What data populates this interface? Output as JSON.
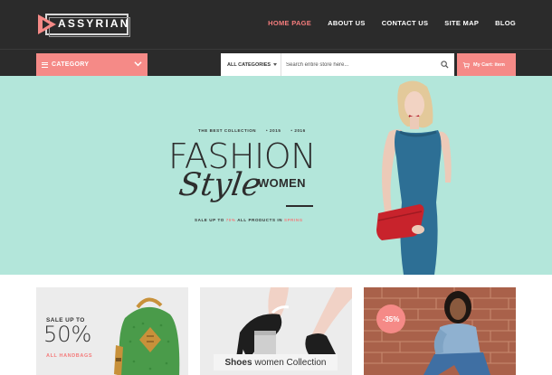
{
  "brand": {
    "logo_text": "ASSYRIAN",
    "accent": "#f58a87",
    "dark": "#2b2b2b"
  },
  "nav": {
    "items": [
      {
        "label": "HOME PAGE",
        "active": true
      },
      {
        "label": "ABOUT US",
        "active": false
      },
      {
        "label": "CONTACT US",
        "active": false
      },
      {
        "label": "SITE MAP",
        "active": false
      },
      {
        "label": "BLOG",
        "active": false
      }
    ]
  },
  "toolbar": {
    "category_label": "CATEGORY",
    "category_icon": "menu-icon",
    "all_categories": "ALL CATEGORIES",
    "search_placeholder": "Search entire store here...",
    "search_icon": "search-icon",
    "cart_label": "My Cart: item",
    "cart_icon": "cart-icon"
  },
  "hero": {
    "background": "#b3e6da",
    "collection": "THE BEST COLLECTION",
    "year1": "• 2015",
    "year2": "• 2016",
    "headline": "FASHION",
    "script": "Style",
    "women": "WOMEN",
    "sale_prefix": "SALE UP TO",
    "sale_pct": "70%",
    "sale_suffix": "ALL PRODUCTS IN",
    "sale_season": "SPRING"
  },
  "tiles": {
    "handbags": {
      "upto": "SALE UP TO",
      "pct": "50%",
      "label": "ALL HANDBAGS"
    },
    "shoes": {
      "bold": "Shoes",
      "rest": "women Collection"
    },
    "discount": {
      "badge": "-35%"
    }
  }
}
